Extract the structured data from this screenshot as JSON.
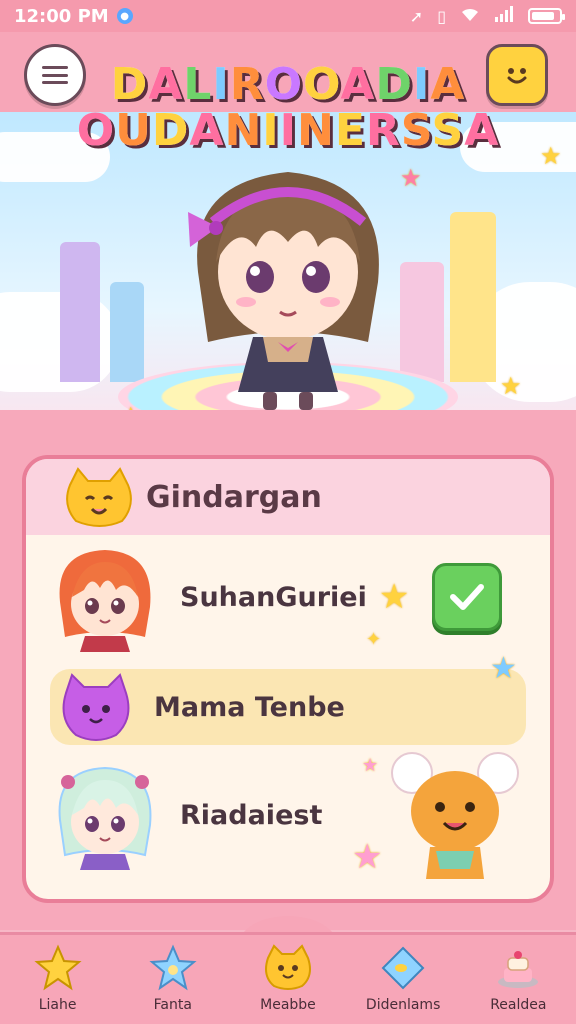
{
  "status_bar": {
    "time": "12:00 PM",
    "left_icons": [
      "notification-badge-icon"
    ],
    "right_icons": [
      "location-arrow-icon",
      "vibrate-icon",
      "wifi-icon",
      "signal-icon",
      "battery-icon"
    ],
    "battery_level": 0.85
  },
  "header": {
    "title_line_1": "DALIROOADIA",
    "title_line_2": "OUDANIINERSSA",
    "menu_icon": "chat-menu-icon",
    "profile_icon": "smiley-face-icon"
  },
  "panel": {
    "title": "Gindargan",
    "header_icon": "yellow-cat-mascot-icon",
    "rows": [
      {
        "label": "SuhanGuriei",
        "avatar": "red-haired-girl-avatar",
        "badge": "star-icon",
        "checked": true
      },
      {
        "label": "Mama Tenbe",
        "avatar": "purple-cat-avatar",
        "highlighted": true
      },
      {
        "label": "Riadaiest",
        "avatar": "mint-haired-girl-avatar",
        "companion": "orange-bear-mascot"
      }
    ]
  },
  "bottom_nav": {
    "items": [
      {
        "label": "Liahe",
        "icon": "star-icon"
      },
      {
        "label": "Fanta",
        "icon": "blue-star-icon"
      },
      {
        "label": "Meabbe",
        "icon": "yellow-cat-icon"
      },
      {
        "label": "Didenlams",
        "icon": "blue-diamond-icon"
      },
      {
        "label": "Realdea",
        "icon": "cake-icon"
      }
    ]
  },
  "colors": {
    "primary_pink": "#f7a6b8",
    "panel_border": "#e97e98",
    "accent_yellow": "#ffd23f",
    "check_green": "#6ad05e"
  }
}
